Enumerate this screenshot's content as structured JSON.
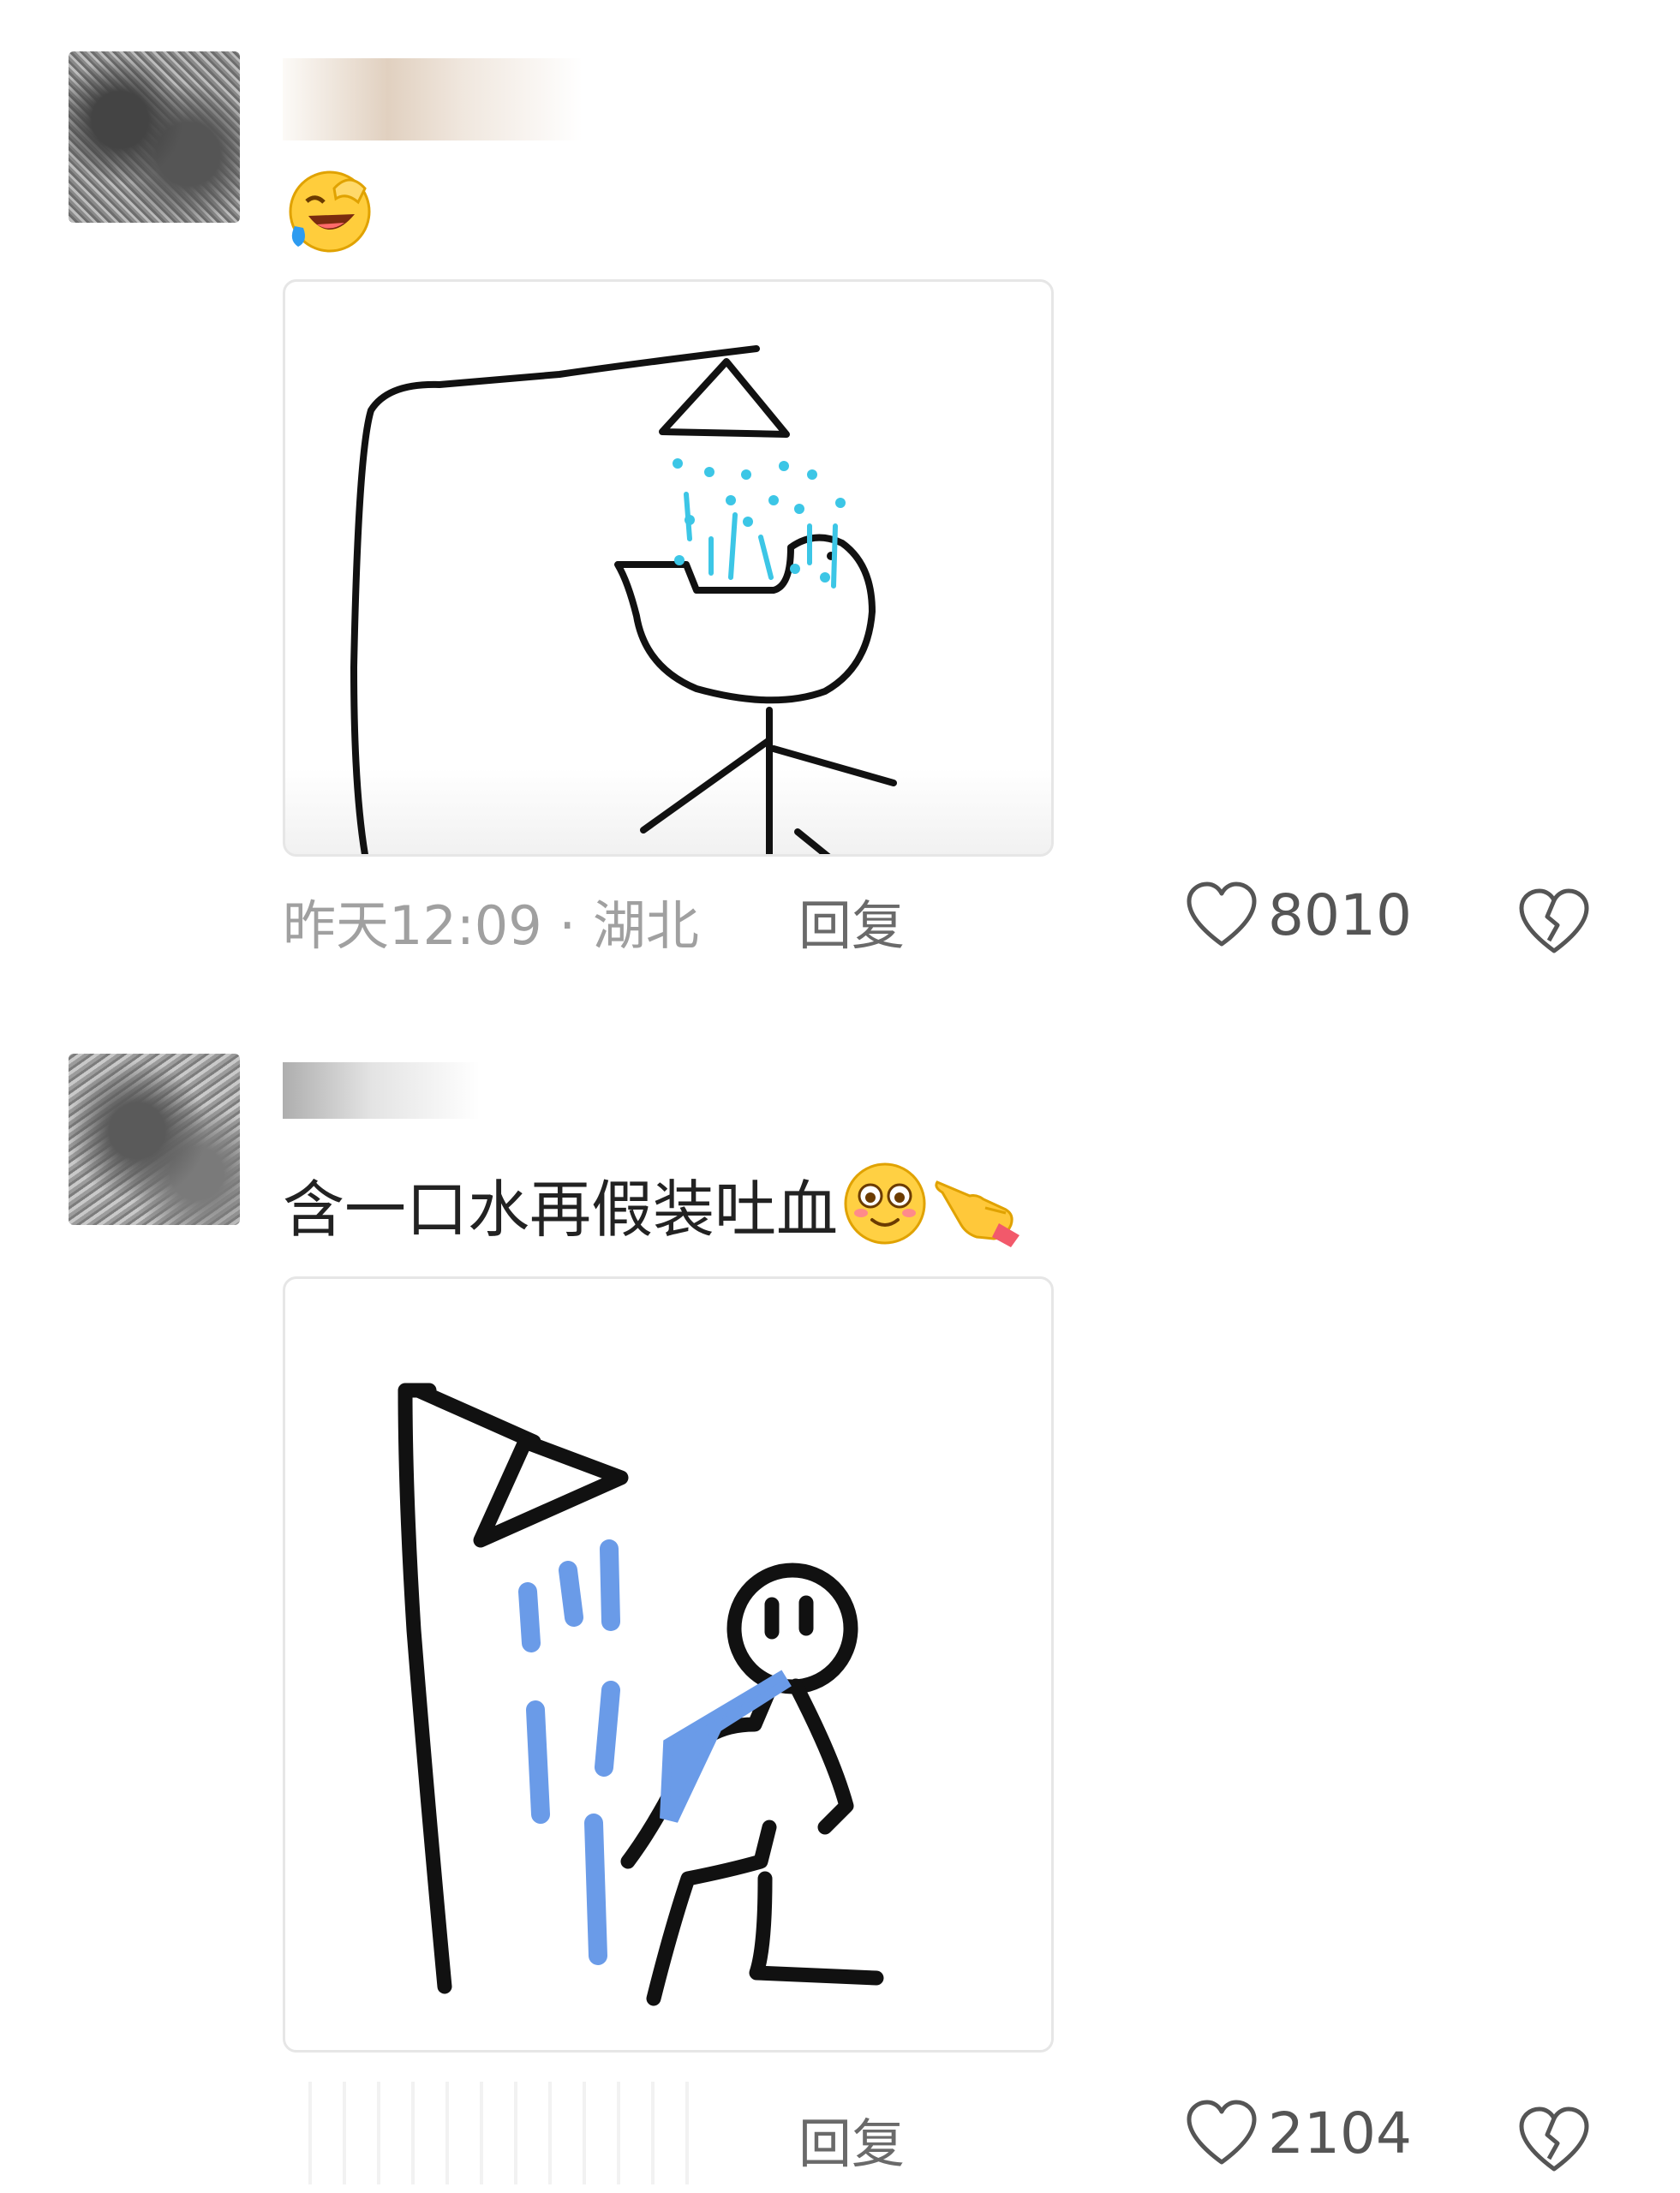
{
  "comments": [
    {
      "text": "",
      "emoji_name": "rolling-laughing-facepalm-icon",
      "time": "昨天12:09",
      "location": "湖北",
      "reply_label": "回复",
      "likes": "8010"
    },
    {
      "text": "含一口水再假装吐血",
      "emoji_names": [
        "blushing-face-icon",
        "pointing-hand-icon"
      ],
      "time": "",
      "location": "",
      "reply_label": "回复",
      "likes": "2104"
    }
  ],
  "colors": {
    "water_cyan": "#3cc6e6",
    "water_blue": "#6a9be8",
    "ink": "#111111",
    "meta_gray": "#a0a0a0"
  }
}
